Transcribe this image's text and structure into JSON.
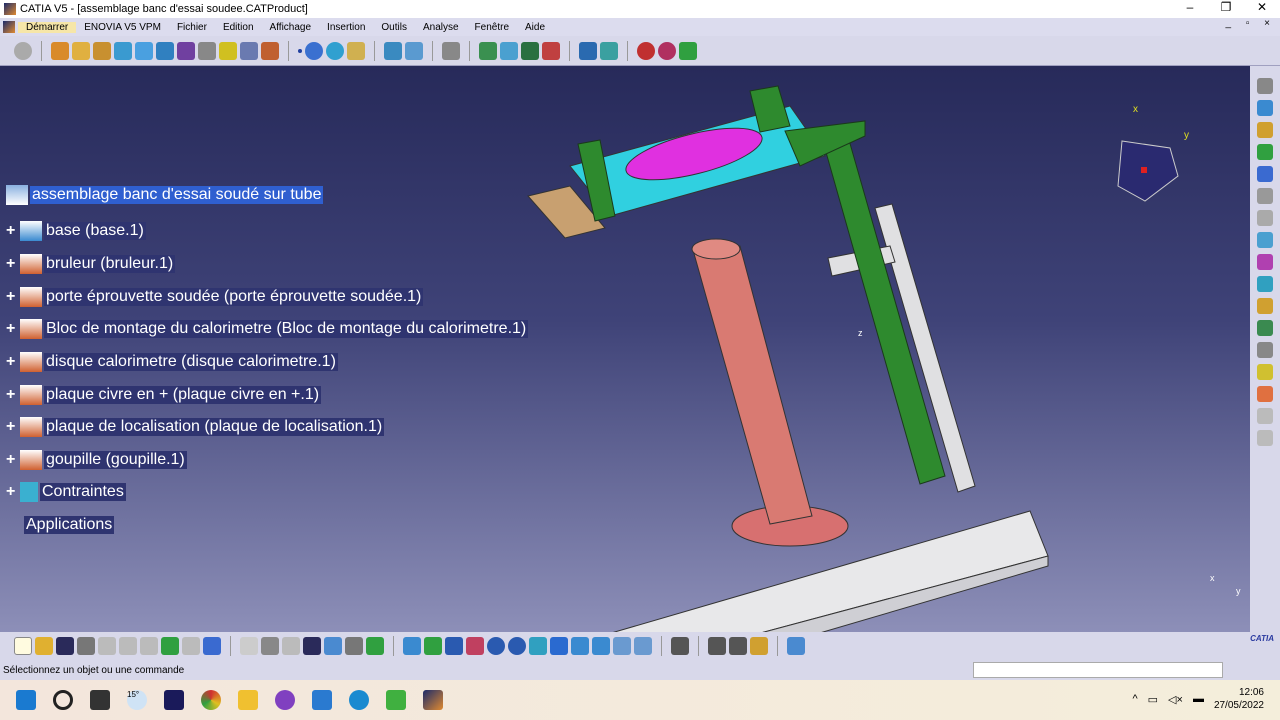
{
  "window": {
    "title": "CATIA V5 - [assemblage banc d'essai soudee.CATProduct]",
    "controls": [
      "–",
      "❐",
      "✕"
    ],
    "mdi": "_ ▫ ×"
  },
  "menu": [
    "Démarrer",
    "ENOVIA V5 VPM",
    "Fichier",
    "Edition",
    "Affichage",
    "Insertion",
    "Outils",
    "Analyse",
    "Fenêtre",
    "Aide"
  ],
  "tree": {
    "root": "assemblage banc d'essai soudé sur tube",
    "items": [
      "base (base.1)",
      "bruleur (bruleur.1)",
      "porte éprouvette soudée (porte éprouvette soudée.1)",
      "Bloc de montage du calorimetre (Bloc de montage du calorimetre.1)",
      "disque calorimetre (disque calorimetre.1)",
      "plaque civre en + (plaque civre en +.1)",
      "plaque de localisation (plaque de localisation.1)",
      "goupille (goupille.1)"
    ],
    "constraints": "Contraintes",
    "applications": "Applications"
  },
  "compass": {
    "x": "x",
    "y": "y"
  },
  "axis_labels": {
    "x": "x",
    "y": "y",
    "z": "z"
  },
  "status": "Sélectionnez un objet ou une commande",
  "logo": "CATIA",
  "taskbar": {
    "weather": "15°",
    "time": "12:06",
    "date": "27/05/2022"
  },
  "colors": {
    "viewport_top": "#272a5a",
    "viewport_bottom": "#8d8fb8",
    "tree_highlight": "#2f5fd0",
    "toolbar": "#d8d8ea"
  }
}
